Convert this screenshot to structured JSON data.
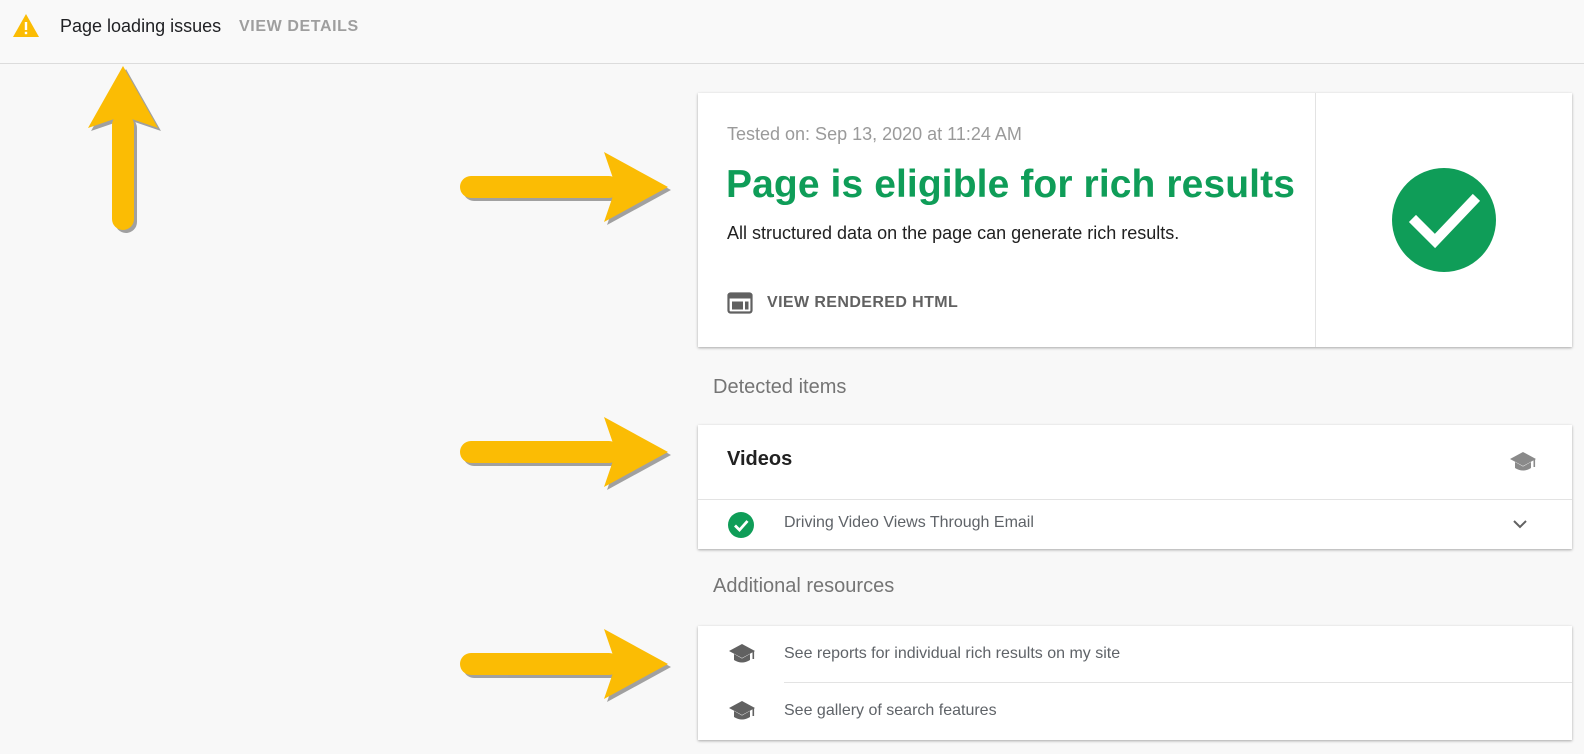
{
  "topbar": {
    "warning_icon": "warning-triangle-icon",
    "warning_text": "Page loading issues",
    "details_label": "VIEW DETAILS"
  },
  "result": {
    "tested_on": "Tested on: Sep 13, 2020 at 11:24 AM",
    "title": "Page is eligible for rich results",
    "description": "All structured data on the page can generate rich results.",
    "view_html_label": "VIEW RENDERED HTML",
    "view_html_icon": "web-page-icon",
    "status_icon": "check-circle-icon"
  },
  "detected": {
    "heading": "Detected items",
    "card_title": "Videos",
    "header_icon": "school-icon",
    "items": [
      {
        "label": "Driving Video Views Through Email",
        "status_icon": "check-circle-icon",
        "expand_icon": "chevron-down-icon"
      }
    ]
  },
  "additional": {
    "heading": "Additional resources",
    "links": [
      {
        "label": "See reports for individual rich results on my site",
        "icon": "school-icon"
      },
      {
        "label": "See gallery of search features",
        "icon": "school-icon"
      }
    ]
  },
  "colors": {
    "success_green": "#0f9d58",
    "warning_yellow": "#fbbc04",
    "annotation_arrow": "#fbbc04",
    "background": "#f8f8f8"
  }
}
